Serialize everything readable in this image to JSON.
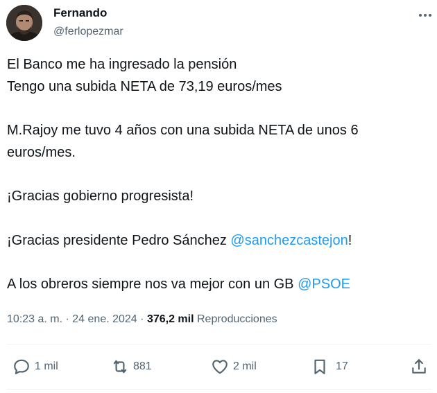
{
  "author": {
    "name": "Fernando",
    "handle": "@ferlopezmar"
  },
  "tweet": {
    "lines": [
      "El Banco me ha ingresado la pensión",
      "Tengo una subida NETA de 73,19 euros/mes",
      "M.Rajoy me tuvo 4 años con una subida NETA de unos 6",
      "euros/mes.",
      "¡Gracias gobierno progresista!",
      "¡Gracias presidente Pedro Sánchez ",
      "@sanchezcastejon",
      "!",
      "A los obreros siempre nos va mejor con un GB ",
      "@PSOE"
    ]
  },
  "meta": {
    "time": "10:23 a. m.",
    "separator": "·",
    "date": "24 ene. 2024",
    "views": "376,2 mil",
    "views_label": "Reproducciones"
  },
  "actions": {
    "replies": "1 mil",
    "reposts": "881",
    "likes": "2 mil",
    "bookmarks": "17"
  },
  "colors": {
    "link": "#1d9bf0",
    "secondary_text": "#536471",
    "primary_text": "#0f1419",
    "divider": "#eff3f4"
  },
  "icons": [
    "more-options-icon",
    "reply-icon",
    "repost-icon",
    "like-icon",
    "bookmark-icon",
    "share-icon"
  ]
}
